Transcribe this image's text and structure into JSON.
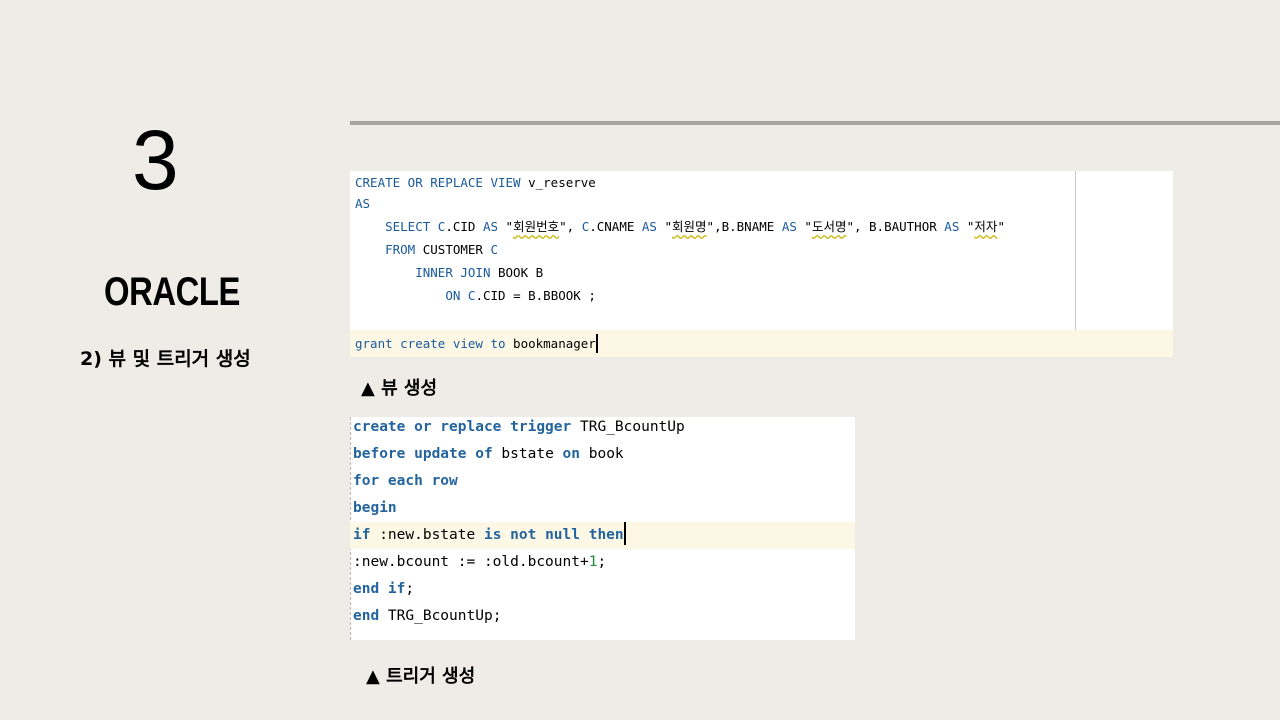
{
  "slide": {
    "number": "3",
    "title": "ORACLE",
    "subtitle": "2) 뷰 및 트리거 생성"
  },
  "view_code": {
    "l1_kw": "CREATE OR REPLACE VIEW",
    "l1_txt": " v_reserve",
    "l2_kw": "AS",
    "l3": {
      "a": "    ",
      "b": "SELECT",
      "c": " ",
      "d": "C",
      "e": ".CID ",
      "f": "AS",
      "g": " \"",
      "h": "회원번호",
      "i": "\", ",
      "j": "C",
      "k": ".CNAME ",
      "l": "AS",
      "m": " \"",
      "n": "회원명",
      "o": "\",B.BNAME ",
      "p": "AS",
      "q": " \"",
      "r": "도서명",
      "s": "\", B.BAUTHOR ",
      "t": "AS",
      "u": " \"",
      "v": "저자",
      "w": "\""
    },
    "l4": {
      "a": "    ",
      "b": "FROM",
      "c": " CUSTOMER ",
      "d": "C"
    },
    "l5": {
      "a": "        ",
      "b": "INNER JOIN",
      "c": " BOOK B"
    },
    "l6": {
      "a": "            ",
      "b": "ON",
      "c": " ",
      "d": "C",
      "e": ".CID = B.BBOOK ;"
    },
    "l8": {
      "a": "grant create view to",
      "b": " bookmanager"
    }
  },
  "trigger_code": {
    "l1": {
      "a": "create or replace trigger",
      "b": " TRG_BcountUp"
    },
    "l2": {
      "a": "before update of",
      "b": " bstate ",
      "c": "on",
      "d": " book"
    },
    "l3": {
      "a": "for each row"
    },
    "l4": {
      "a": "begin"
    },
    "l5": {
      "a": "if",
      "b": " :new.bstate ",
      "c": "is not null then"
    },
    "l6": {
      "a": ":new.bcount := :old.bcount+",
      "b": "1",
      "c": ";"
    },
    "l7": {
      "a": "end if",
      "b": ";"
    },
    "l8": {
      "a": "end",
      "b": " TRG_BcountUp;"
    }
  },
  "captions": {
    "view": "▲ 뷰 생성",
    "trigger": "▲ 트리거 생성"
  }
}
